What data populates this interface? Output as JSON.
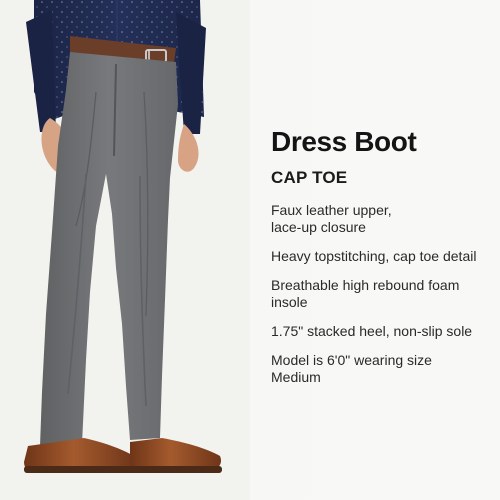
{
  "product": {
    "title": "Dress Boot",
    "subtitle": "CAP TOE",
    "features": [
      {
        "lines": [
          "Faux leather upper,",
          "lace-up closure"
        ]
      },
      {
        "lines": [
          "Heavy topstitching, cap toe detail"
        ]
      },
      {
        "lines": [
          "Breathable high rebound foam",
          "insole"
        ]
      },
      {
        "lines": [
          "1.75\" stacked heel, non-slip sole"
        ]
      },
      {
        "lines": [
          "Model is 6'0\" wearing size",
          "Medium"
        ]
      }
    ]
  },
  "colors": {
    "background": "#f6f6f4",
    "shirt": "#1f2a4f",
    "pants": "#6f7174",
    "belt": "#6b3e29",
    "boots": "#8b4a24"
  }
}
